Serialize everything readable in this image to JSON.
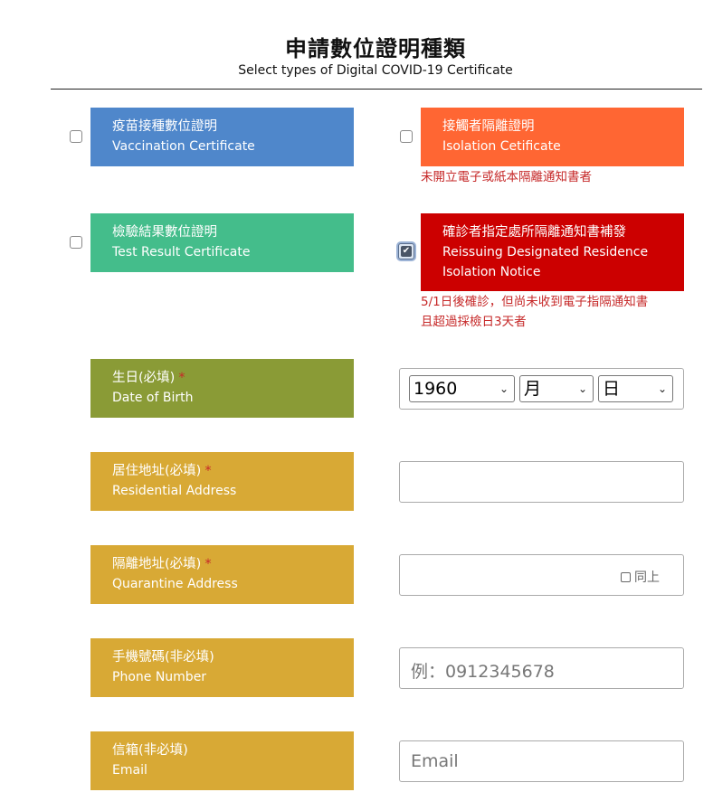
{
  "header": {
    "title": "申請數位證明種類",
    "subtitle": "Select types of Digital COVID-19 Certificate"
  },
  "certificates": {
    "vaccination": {
      "zh": "疫苗接種數位證明",
      "en": "Vaccination Certificate",
      "checked": false,
      "color": "#4f87cb"
    },
    "isolation": {
      "zh": "接觸者隔離證明",
      "en": "Isolation Cetificate",
      "checked": false,
      "color": "#ff6633",
      "note": "未開立電子或紙本隔離通知書者"
    },
    "test_result": {
      "zh": "檢驗結果數位證明",
      "en": "Test Result Certificate",
      "checked": false,
      "color": "#44bd8b"
    },
    "reissue": {
      "zh": "確診者指定處所隔離通知書補發",
      "en_line1": "Reissuing Designated Residence",
      "en_line2": "Isolation Notice",
      "checked": true,
      "color": "#cc0000",
      "note_line1": "5/1日後確診，但尚未收到電子指隔通知書",
      "note_line2": "且超過採檢日3天者"
    }
  },
  "form": {
    "required_mark": "*",
    "birth": {
      "zh": "生日(必填)",
      "en": "Date of Birth",
      "year": "1960",
      "month": "月",
      "day": "日"
    },
    "residential": {
      "zh": "居住地址(必填)",
      "en": "Residential Address",
      "value": ""
    },
    "quarantine": {
      "zh": "隔離地址(必填)",
      "en": "Quarantine Address",
      "value": "",
      "same_label": "同上"
    },
    "phone": {
      "zh": "手機號碼(非必填)",
      "en": "Phone Number",
      "placeholder": "例：0912345678"
    },
    "email": {
      "zh": "信箱(非必填)",
      "en": "Email",
      "placeholder": "Email"
    }
  },
  "colors": {
    "label_birth": "#8a9b36",
    "label_form": "#d8a935",
    "required": "#c62828"
  }
}
